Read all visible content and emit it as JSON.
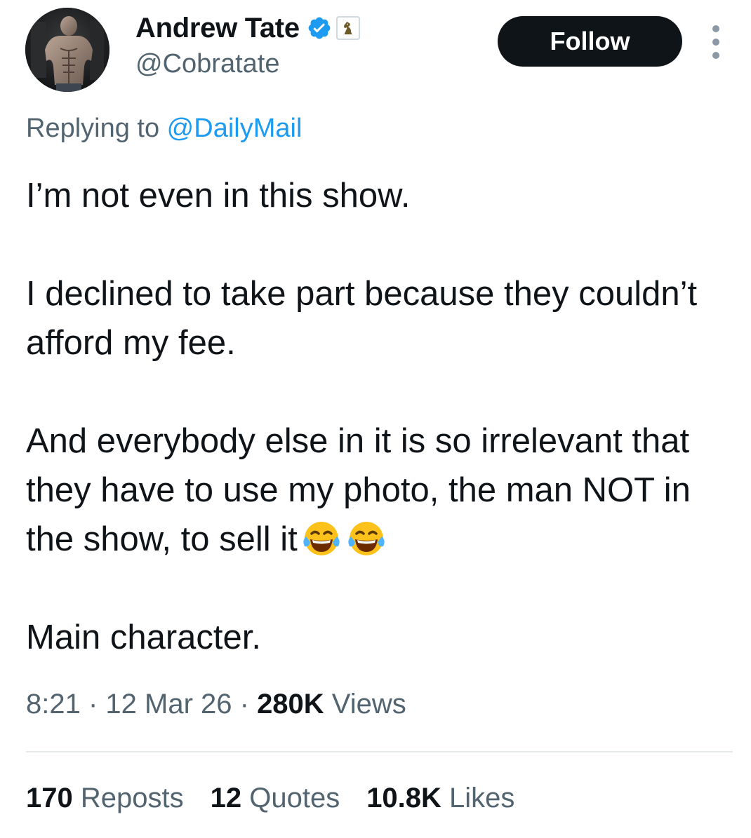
{
  "author": {
    "display_name": "Andrew Tate",
    "handle": "@Cobratate",
    "verified_icon": "verified-badge-icon",
    "affiliate_icon": "chess-knight-icon"
  },
  "actions": {
    "follow_label": "Follow",
    "more_icon": "more-vertical-icon"
  },
  "reply": {
    "prefix": "Replying to ",
    "mention": "@DailyMail"
  },
  "tweet": {
    "paragraphs": [
      "I’m not even in this show.",
      "I declined to take part because they couldn’t afford my fee.",
      "And everybody else in it is so irrelevant that they have to use my photo, the man NOT in the show, to sell it",
      "Main character."
    ],
    "emoji_icon": "face-with-tears-of-joy-icon"
  },
  "meta": {
    "time": "8:21",
    "sep1": " · ",
    "date": "12 Mar 26",
    "sep2": " · ",
    "views_count": "280K",
    "views_label": " Views"
  },
  "stats": {
    "reposts_count": "170",
    "reposts_label": " Reposts",
    "quotes_count": "12",
    "quotes_label": " Quotes",
    "likes_count": "10.8K",
    "likes_label": " Likes"
  },
  "colors": {
    "text_primary": "#0f1419",
    "text_secondary": "#536471",
    "link": "#1d9bf0",
    "follow_bg": "#0f1419",
    "verified": "#1d9bf0",
    "divider": "#e4e9ec"
  }
}
